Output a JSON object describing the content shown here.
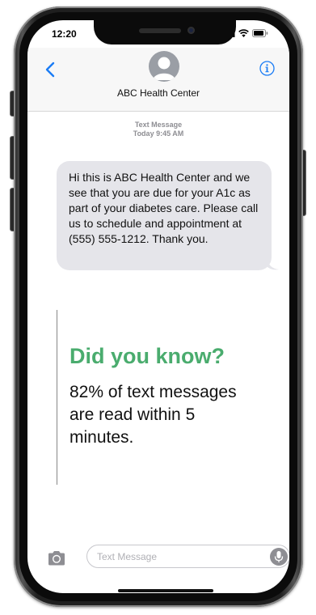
{
  "status_bar": {
    "time": "12:20",
    "signal_icon": "cellular-signal-icon",
    "wifi_icon": "wifi-icon",
    "battery_icon": "battery-icon"
  },
  "header": {
    "back_icon": "chevron-left-icon",
    "avatar_icon": "person-avatar-icon",
    "contact_name": "ABC Health Center",
    "info_icon": "info-icon"
  },
  "thread": {
    "meta_label": "Text Message",
    "meta_time": "Today 9:45 AM",
    "messages": [
      {
        "direction": "incoming",
        "text": "Hi this is ABC Health Center and we see that you are due for your A1c as part of your diabetes care. Please call us to schedule and appointment at (555) 555-1212. Thank you."
      }
    ]
  },
  "callout": {
    "title": "Did you know?",
    "body": "82% of text messages are read within 5 minutes."
  },
  "composer": {
    "camera_icon": "camera-icon",
    "placeholder": "Text Message",
    "value": "",
    "mic_icon": "microphone-icon"
  },
  "colors": {
    "accent_blue": "#1a7cf5",
    "callout_green": "#4aac6e",
    "bubble_gray": "#e5e5ea",
    "header_bg": "#f7f7f7"
  }
}
